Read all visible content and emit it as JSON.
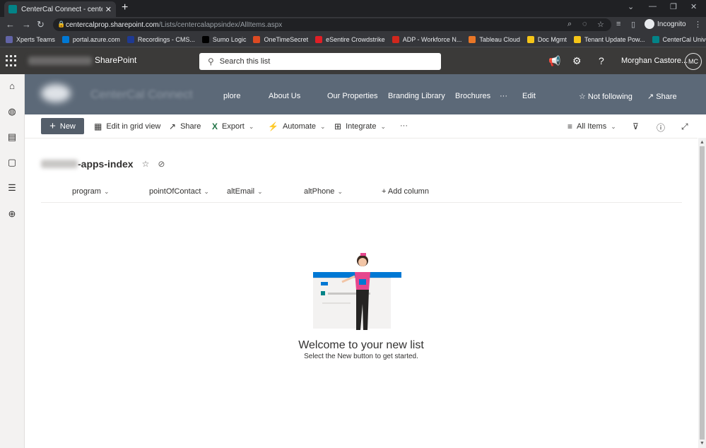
{
  "browser": {
    "tab_title": "CenterCal Connect - centercal-ap",
    "url_domain": "centercalprop.sharepoint.com",
    "url_path": "/Lists/centercalappsindex/AllItems.aspx",
    "profile_label": "Incognito",
    "bookmarks": [
      {
        "label": "Xperts Teams",
        "color": "#6264a7"
      },
      {
        "label": "portal.azure.com",
        "color": "#0078d4"
      },
      {
        "label": "Recordings - CMS...",
        "color": "#1f3a93"
      },
      {
        "label": "Sumo Logic",
        "color": "#000000"
      },
      {
        "label": "OneTimeSecret",
        "color": "#dc4a22"
      },
      {
        "label": "eSentire Crowdstrike",
        "color": "#e01f26"
      },
      {
        "label": "ADP - Workforce N...",
        "color": "#d0271d"
      },
      {
        "label": "Tableau Cloud",
        "color": "#e97627"
      },
      {
        "label": "Doc Mgmt",
        "color": "#f5c518"
      },
      {
        "label": "Tenant Update Pow...",
        "color": "#f5c518"
      },
      {
        "label": "CenterCal Universit...",
        "color": "#038387"
      }
    ]
  },
  "suite": {
    "app_name": "SharePoint",
    "search_placeholder": "Search this list",
    "user_name": "Morghan Castore...",
    "user_initials": "MC"
  },
  "site": {
    "title": "CenterCal Connect",
    "nav": [
      "plore",
      "About Us",
      "Our Properties",
      "Branding Library",
      "Brochures",
      "···",
      "Edit"
    ],
    "follow_label": "Not following",
    "share_label": "Share"
  },
  "command_bar": {
    "new_label": "New",
    "grid_label": "Edit in grid view",
    "share_label": "Share",
    "export_label": "Export",
    "automate_label": "Automate",
    "integrate_label": "Integrate",
    "more_label": "···",
    "view_label": "All Items"
  },
  "list": {
    "title_suffix": "-apps-index",
    "columns": [
      "program",
      "pointOfContact",
      "altEmail",
      "altPhone"
    ],
    "add_column_label": "+ Add column"
  },
  "empty_state": {
    "title": "Welcome to your new list",
    "subtitle": "Select the New button to get started."
  },
  "colors": {
    "suite_bar": "#3b3a39",
    "site_header": "#5c6978",
    "new_button": "#545e6a"
  }
}
